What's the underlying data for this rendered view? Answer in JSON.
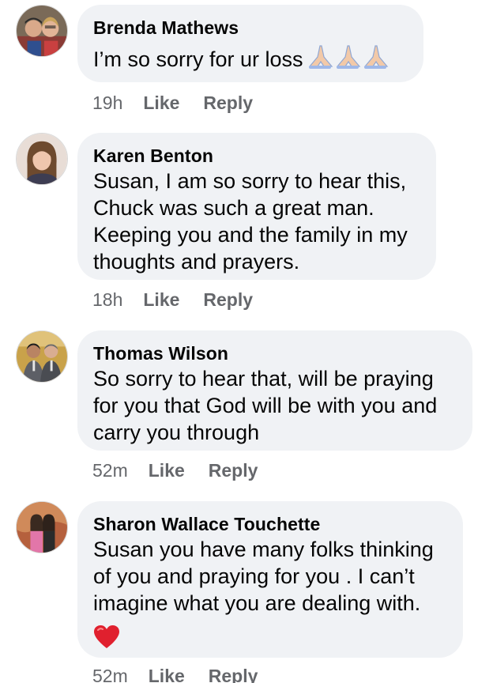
{
  "comments": [
    {
      "author": "Brenda Mathews",
      "text": "I’m so sorry for ur loss",
      "emoji": [
        "praying-hands",
        "praying-hands",
        "praying-hands"
      ],
      "time": "19h",
      "like_label": "Like",
      "reply_label": "Reply"
    },
    {
      "author": "Karen Benton",
      "lines": [
        "Susan, I am so sorry to hear this,",
        "Chuck was such a great man.",
        "Keeping you and the family in my",
        "thoughts and prayers."
      ],
      "time": "18h",
      "like_label": "Like",
      "reply_label": "Reply"
    },
    {
      "author": "Thomas Wilson",
      "lines": [
        "So sorry to hear that, will be praying",
        "for you that God will be with you and",
        "carry you through"
      ],
      "time": "52m",
      "like_label": "Like",
      "reply_label": "Reply"
    },
    {
      "author": "Sharon Wallace Touchette",
      "lines": [
        "Susan you have many folks thinking",
        "of you and praying for you . I can’t",
        "imagine what you are dealing with."
      ],
      "emoji": [
        "red-heart"
      ],
      "time": "52m",
      "like_label": "Like",
      "reply_label": "Reply"
    }
  ],
  "colors": {
    "bubble": "#f0f2f5",
    "meta_text": "#65676b",
    "heart": "#e0202e"
  }
}
